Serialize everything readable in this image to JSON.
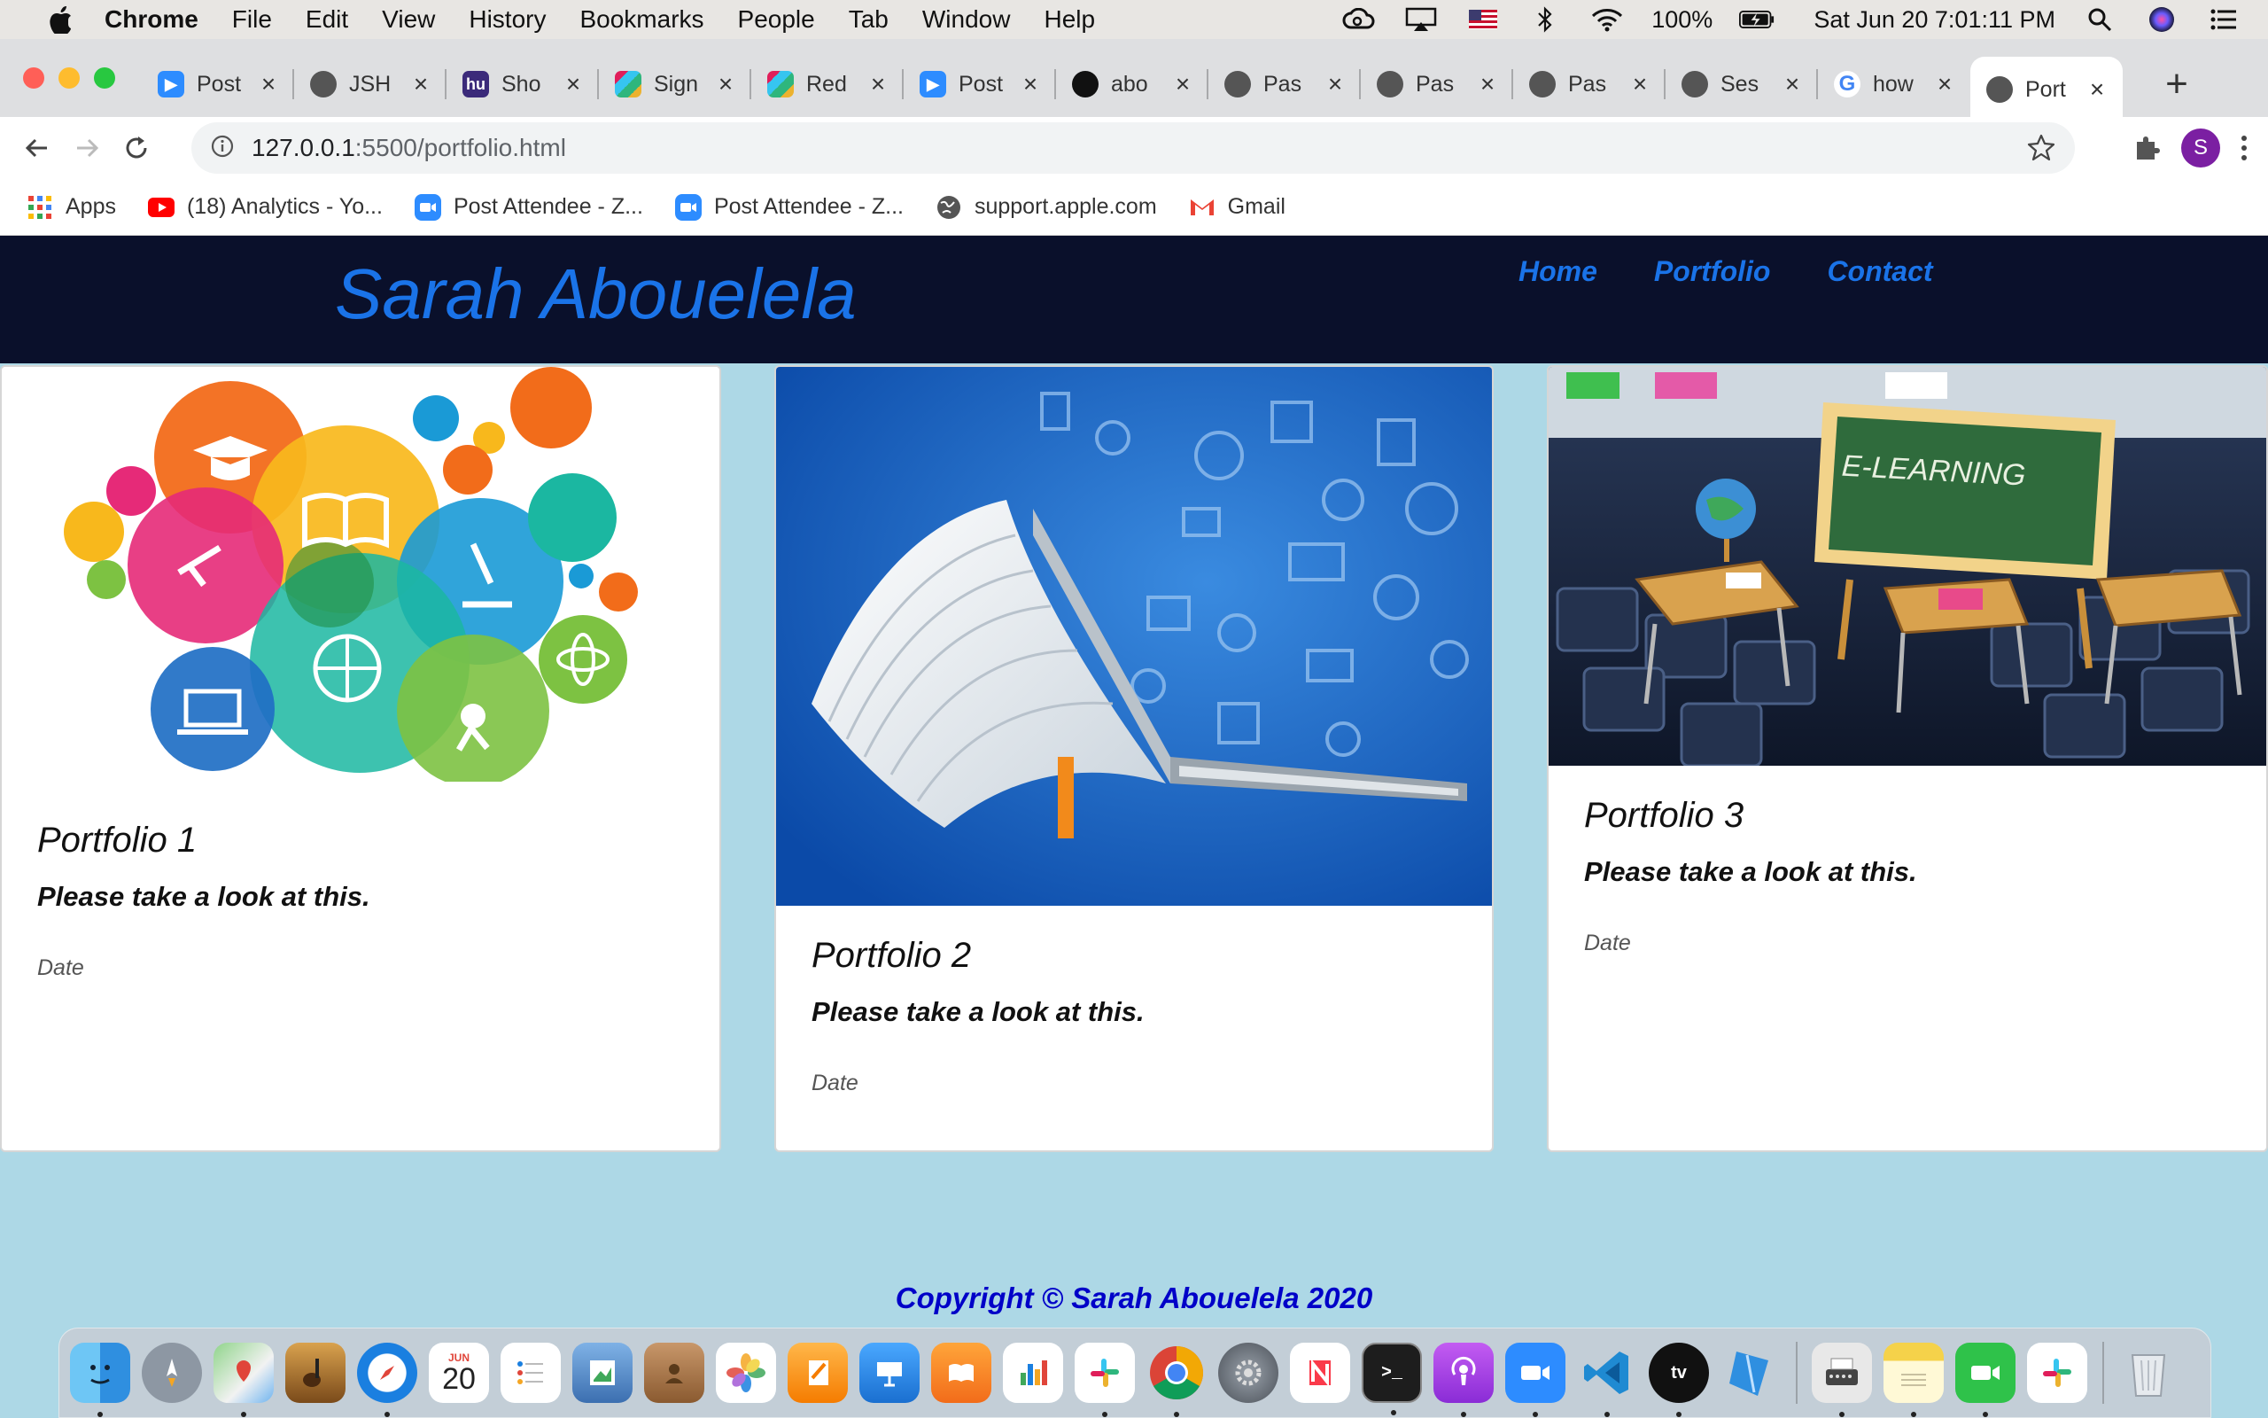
{
  "menubar": {
    "app": "Chrome",
    "items": [
      "File",
      "Edit",
      "View",
      "History",
      "Bookmarks",
      "People",
      "Tab",
      "Window",
      "Help"
    ],
    "battery": "100%",
    "clock": "Sat Jun 20  7:01:11 PM"
  },
  "tabs": [
    {
      "title": "Post",
      "icon": "zoom-icon"
    },
    {
      "title": "JSH",
      "icon": "globe-icon"
    },
    {
      "title": "Sho",
      "icon": "hu-icon"
    },
    {
      "title": "Sign",
      "icon": "slack-icon"
    },
    {
      "title": "Red",
      "icon": "slack-icon"
    },
    {
      "title": "Post",
      "icon": "zoom-icon"
    },
    {
      "title": "abo",
      "icon": "github-icon"
    },
    {
      "title": "Pas",
      "icon": "globe-icon"
    },
    {
      "title": "Pas",
      "icon": "globe-icon"
    },
    {
      "title": "Pas",
      "icon": "globe-icon"
    },
    {
      "title": "Ses",
      "icon": "globe-icon"
    },
    {
      "title": "how",
      "icon": "google-icon"
    },
    {
      "title": "Port",
      "icon": "globe-icon",
      "active": true
    }
  ],
  "toolbar": {
    "url_host": "127.0.0.1",
    "url_path": ":5500/portfolio.html",
    "avatar_letter": "S"
  },
  "bookmarks": [
    {
      "label": "Apps",
      "icon": "apps-grid-icon"
    },
    {
      "label": "(18) Analytics - Yo...",
      "icon": "youtube-icon"
    },
    {
      "label": "Post Attendee - Z...",
      "icon": "zoom-icon"
    },
    {
      "label": "Post Attendee - Z...",
      "icon": "zoom-icon"
    },
    {
      "label": "support.apple.com",
      "icon": "globe-icon"
    },
    {
      "label": "Gmail",
      "icon": "gmail-icon"
    }
  ],
  "site": {
    "title": "Sarah Abouelela",
    "nav": [
      "Home",
      "Portfolio",
      "Contact"
    ],
    "cards": [
      {
        "title": "Portfolio 1",
        "text": "Please take a look at this.",
        "date": "Date",
        "image": "education-circles-illustration"
      },
      {
        "title": "Portfolio 2",
        "text": "Please take a look at this.",
        "date": "Date",
        "image": "book-laptop-illustration"
      },
      {
        "title": "Portfolio 3",
        "text": "Please take a look at this.",
        "date": "Date",
        "image": "e-learning-laptop-illustration",
        "chalkboard": "E-LEARNING"
      }
    ],
    "copyright": "Copyright © Sarah Abouelela 2020"
  },
  "colors": {
    "page_bg": "#add8e6",
    "header_bg": "#0a102b",
    "accent": "#1a73e8",
    "copyright": "#0000c8"
  },
  "dock": {
    "calendar_month": "JUN",
    "calendar_day": "20",
    "apps": [
      "finder",
      "launchpad",
      "maps",
      "garageband",
      "safari",
      "calendar",
      "reminders",
      "preview",
      "contacts",
      "photos",
      "pages",
      "keynote",
      "books",
      "numbers",
      "slack",
      "chrome",
      "system-preferences",
      "news",
      "terminal",
      "podcasts",
      "zoom",
      "vscode",
      "apple-tv",
      "xcode-instruments",
      "typewriter",
      "notes",
      "facetime",
      "slack-2",
      "trash"
    ]
  }
}
